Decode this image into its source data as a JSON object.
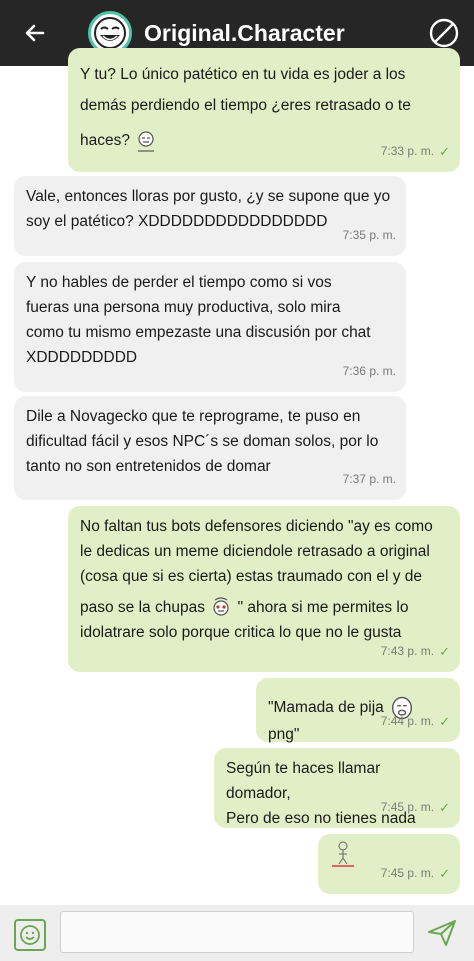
{
  "header": {
    "title": "Original.Character",
    "back_icon": "arrow-left-icon",
    "avatar_icon": "trollface-icon",
    "block_icon": "block-icon"
  },
  "messages": [
    {
      "type": "sent",
      "lines": [
        "Y tu? Lo único patético en tu vida es joder a los",
        "demás perdiendo el tiempo ¿eres retrasado o te",
        "haces?"
      ],
      "time": "7:33 p. m."
    },
    {
      "type": "received",
      "lines": [
        "Vale, entonces lloras por gusto, ¿y se supone que yo",
        "soy el patético? XDDDDDDDDDDDDDDDD"
      ],
      "time": "7:35 p. m."
    },
    {
      "type": "received",
      "lines": [
        "Y no hables de perder el tiempo como si vos",
        "fueras una persona muy productiva, solo mira",
        "como tu mismo empezaste una discusión por chat",
        "XDDDDDDDDD"
      ],
      "time": "7:36 p. m."
    },
    {
      "type": "received",
      "lines": [
        "Dile a Novagecko que te reprograme, te puso en",
        "dificultad fácil y esos NPC´s se doman solos, por lo",
        "tanto no son entretenidos de domar"
      ],
      "time": "7:37 p. m."
    },
    {
      "type": "sent",
      "lines": [
        "No faltan tus bots defensores diciendo \"ay es como",
        "le dedicas un meme diciendole retrasado a original",
        "(cosa que si es cierta) estas traumado con el y de",
        "paso se la chupas",
        "\" ahora si me permites lo",
        "idolatrare solo porque critica lo que no le gusta"
      ],
      "time": "7:43 p. m."
    },
    {
      "type": "sent",
      "lines": [
        "\"Mamada de pija ",
        "png\""
      ],
      "time": "7:44 p. m."
    },
    {
      "type": "sent",
      "lines": [
        "Según te haces llamar domador,",
        "Pero de eso no tienes nada"
      ],
      "time": "7:45 p. m."
    },
    {
      "type": "sent",
      "lines": [],
      "time": "7:45 p. m."
    }
  ],
  "composer": {
    "placeholder": "",
    "emoji_icon": "smiley-icon",
    "send_icon": "send-icon"
  },
  "colors": {
    "topbar": "#262626",
    "sent_bubble": "#e2efc6",
    "received_bubble": "#f0f0f0",
    "check": "#6aa84f"
  }
}
